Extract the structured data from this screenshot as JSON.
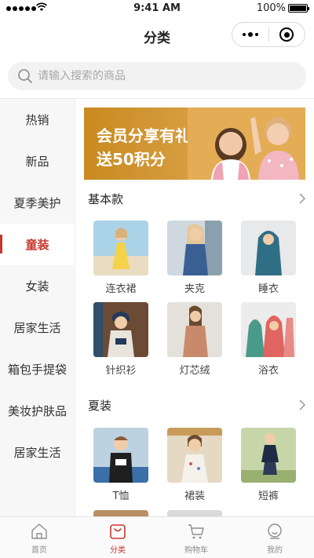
{
  "status_bar": {
    "time": "9:41 AM",
    "battery": "100%"
  },
  "nav": {
    "title": "分类"
  },
  "search": {
    "placeholder": "请输入搜索的商品"
  },
  "sidebar": {
    "items": [
      {
        "label": "热销"
      },
      {
        "label": "新品"
      },
      {
        "label": "夏季美护"
      },
      {
        "label": "童装",
        "active": true
      },
      {
        "label": "女装"
      },
      {
        "label": "居家生活"
      },
      {
        "label": "箱包手提袋"
      },
      {
        "label": "美妆护肤品"
      },
      {
        "label": "居家生活"
      }
    ]
  },
  "banner": {
    "line1": "会员分享有礼",
    "line2": "送50积分"
  },
  "sections": [
    {
      "title": "基本款",
      "items": [
        {
          "label": "连衣裙"
        },
        {
          "label": "夹克"
        },
        {
          "label": "睡衣"
        },
        {
          "label": "针织衫"
        },
        {
          "label": "灯芯绒"
        },
        {
          "label": "浴衣"
        }
      ]
    },
    {
      "title": "夏装",
      "items": [
        {
          "label": "T恤"
        },
        {
          "label": "裙装"
        },
        {
          "label": "短裤"
        }
      ]
    }
  ],
  "tabbar": {
    "items": [
      {
        "label": "首页",
        "icon": "home-icon"
      },
      {
        "label": "分类",
        "icon": "category-icon",
        "active": true
      },
      {
        "label": "购物车",
        "icon": "cart-icon"
      },
      {
        "label": "我的",
        "icon": "profile-icon"
      }
    ]
  },
  "colors": {
    "accent": "#c8372d",
    "sidebar_bg": "#f7f7f7",
    "banner": "#d8a046"
  }
}
